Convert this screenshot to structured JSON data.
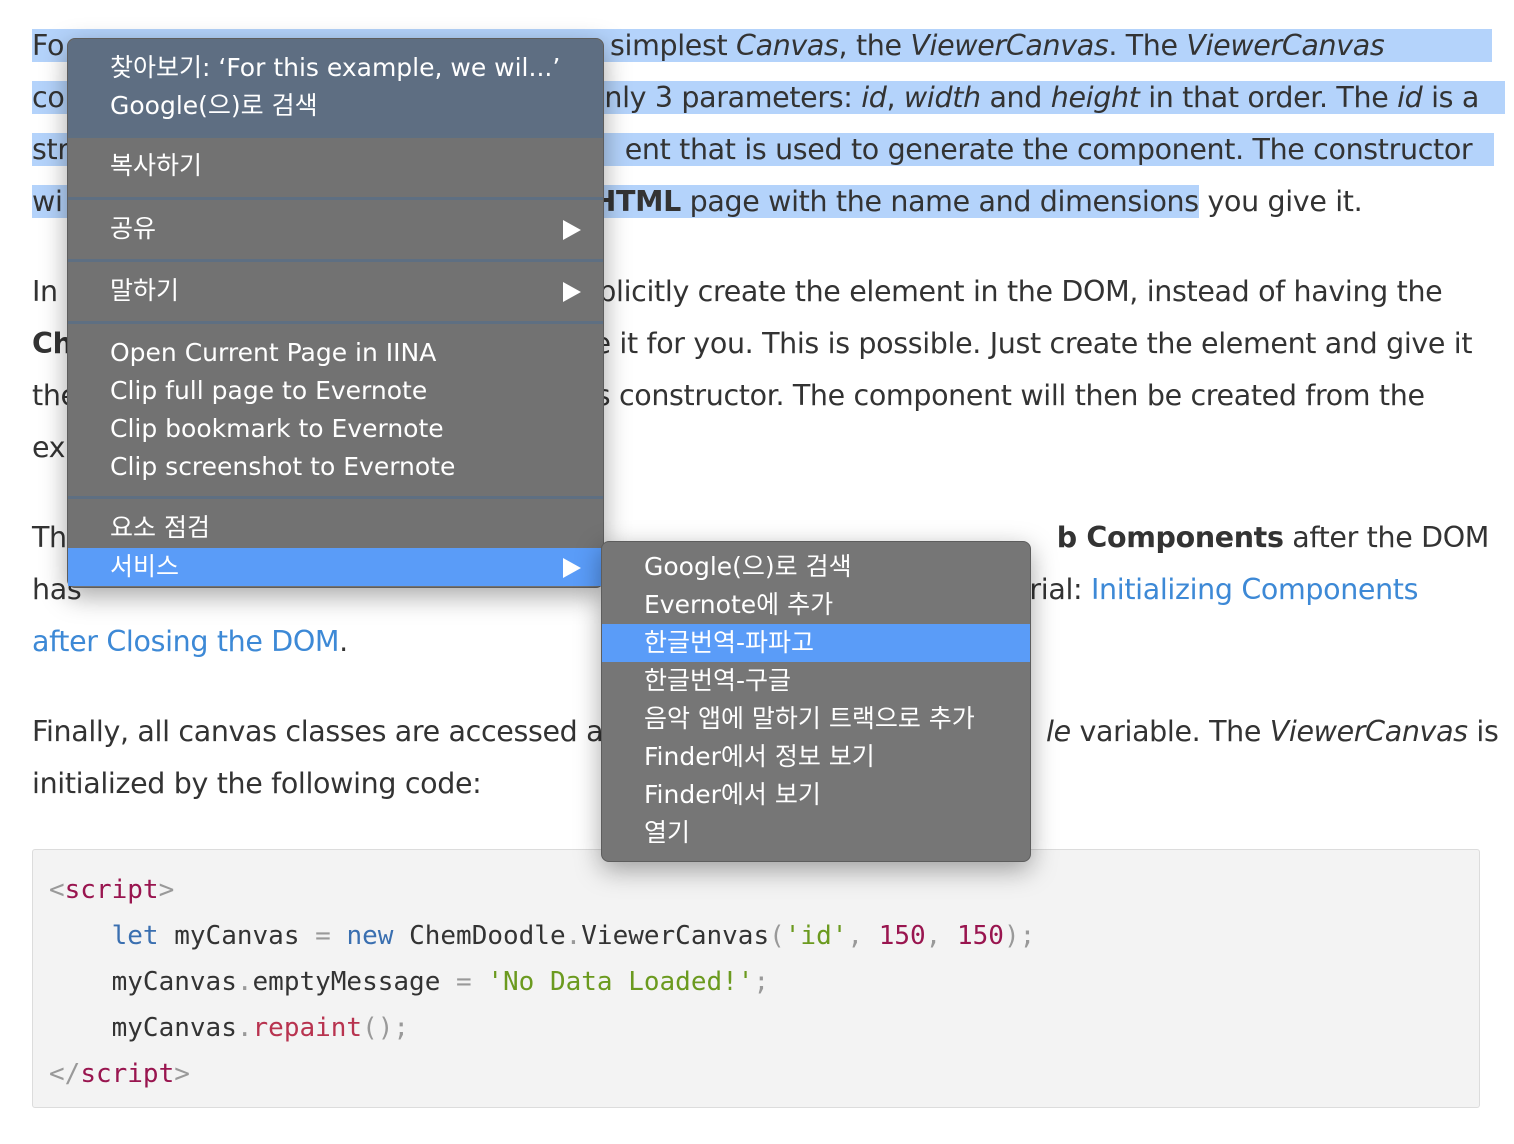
{
  "article": {
    "p1": {
      "l1a": "Fo",
      "l1b": "e simplest ",
      "l1c": "Canvas",
      "l1d": ", the ",
      "l1e": "ViewerCanvas",
      "l1f": ". The ",
      "l1g": "ViewerCanvas",
      "l2a": "co",
      "l2b": "nly 3 parameters: ",
      "l2c": "id",
      "l2d": ", ",
      "l2e": "width",
      "l2f": " and ",
      "l2g": "height",
      "l2h": " in that order. The ",
      "l2i": "id",
      "l2j": " is a",
      "l3a": "str",
      "l3b": "ent that is used to generate the component. The constructor",
      "l4a": "wi",
      "l4b": "HTML",
      "l4c": " page with the name and dimensions",
      "l4d": " you give it."
    },
    "p2": {
      "l1a": "In",
      "l1b": "xplicitly create the element in the DOM, instead of having the",
      "l2a": "Ch",
      "l2b": "e it for you. This is possible. Just create the element and give it",
      "l3a": "the",
      "l3b": "s constructor. The component will then be created from the",
      "l4a": "exi"
    },
    "p3": {
      "l1a": "Th",
      "l1b": "b Components",
      "l1c": " after the DOM",
      "l2a": "has",
      "l2b": "orial: ",
      "l2c": "Initializing Components",
      "l3a": "after Closing the DOM",
      "l3b": "."
    },
    "p4": {
      "l1a": "Finally, all canvas classes are accessed at",
      "l1b": "le",
      "l1c": " variable. The ",
      "l1d": "ViewerCanvas",
      "l1e": " is",
      "l2a": "initialized by the following code:"
    }
  },
  "code": {
    "line1": {
      "lt": "<",
      "tag": "script",
      "gt": ">"
    },
    "line2": {
      "indent": "    ",
      "kw_let": "let",
      "var": " myCanvas ",
      "eq": "=",
      "sp": " ",
      "kw_new": "new",
      "cls": " ChemDoodle",
      "dot": ".",
      "ctor": "ViewerCanvas",
      "open": "(",
      "s_id": "'id'",
      "c1": ", ",
      "n1": "150",
      "c2": ", ",
      "n2": "150",
      "close": ");"
    },
    "line3": {
      "indent": "    ",
      "obj": "myCanvas",
      "dot": ".",
      "prop": "emptyMessage ",
      "eq": "=",
      "sp": " ",
      "str": "'No Data Loaded!'",
      "semi": ";"
    },
    "line4": {
      "indent": "    ",
      "obj": "myCanvas",
      "dot": ".",
      "fn": "repaint",
      "parens": "();"
    },
    "line5": {
      "lt": "</",
      "tag": "script",
      "gt": ">"
    }
  },
  "context_menu": {
    "lookup": "찾아보기: ‘For this example, we wil...’",
    "search_google": "Google(으)로 검색",
    "copy": "복사하기",
    "share": "공유",
    "speech": "말하기",
    "open_iina": "Open Current Page in IINA",
    "clip_full": "Clip full page to Evernote",
    "clip_bookmark": "Clip bookmark to Evernote",
    "clip_screenshot": "Clip screenshot to Evernote",
    "inspect": "요소 점검",
    "services": "서비스"
  },
  "services_menu": {
    "items": [
      "Google(으)로 검색",
      "Evernote에 추가",
      "한글번역-파파고",
      "한글번역-구글",
      "음악 앱에 말하기 트랙으로 추가",
      "Finder에서 정보 보기",
      "Finder에서 보기",
      "열기"
    ],
    "highlighted_index": 2
  },
  "colors": {
    "selection": "#b4d3fb",
    "menu_bg": "#727272",
    "menu_highlight": "#5a9cf8",
    "link": "#3d89d6"
  }
}
